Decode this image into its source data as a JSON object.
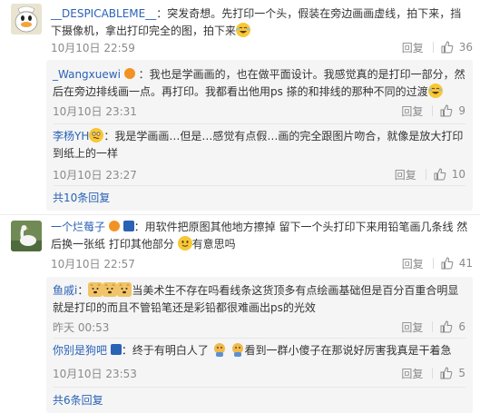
{
  "comments": [
    {
      "user": "__DESPICABLEME__",
      "text": "：突发奇想。先打印一个头，假装在旁边画画虚线，拍下来，挡下摄像机，拿出打印完全的图，拍下来",
      "time": "10月10日 22:59",
      "reply_label": "回复",
      "likes": "36",
      "replies": [
        {
          "user": "_Wangxuewi",
          "text": "：我也是学画画的，也在做平面设计。我感觉真的是打印一部分，然后在旁边排线画一点。再打印。我都看出他用ps 搽的和排线的那种不同的过渡",
          "time": "10月10日 23:31",
          "reply_label": "回复",
          "likes": "9"
        },
        {
          "user": "李杨YH",
          "text": "：我是学画画…但是…感觉有点假…画的完全跟图片吻合，就像是放大打印到纸上的一样",
          "time": "10月10日 23:27",
          "reply_label": "回复",
          "likes": "10"
        }
      ],
      "more": "共10条回复"
    },
    {
      "user": "一个烂莓子",
      "text": "：用软件把原图其他地方擦掉 留下一个头打印下来用铅笔画几条线 然后换一张纸 打印其他部分",
      "text_tail": "有意思吗",
      "time": "10月10日 22:57",
      "reply_label": "回复",
      "likes": "41",
      "replies": [
        {
          "user": "鱼戚i",
          "text": "：",
          "text_body": "当美术生不存在吗看线条这货顶多有点绘画基础但是百分百重合明显就是打印的而且不管铅笔还是彩铅都很难画出ps的光效",
          "time": "昨天 00:53",
          "reply_label": "回复",
          "likes": "6"
        },
        {
          "user": "你别是狗吧",
          "text": "：终于有明白人了",
          "text_tail": "看到一群小傻子在那说好厉害我真是干着急",
          "time": "10月10日 23:53",
          "reply_label": "回复",
          "likes": "5"
        }
      ],
      "more": "共6条回复"
    }
  ],
  "colors": {
    "link": "#2a62b6",
    "meta": "#8a8a8a",
    "reply_bg": "#f5f5f5"
  },
  "icons": [
    "avatar-duck",
    "avatar-goose",
    "verified-badge",
    "like-icon",
    "laugh-emoji",
    "confused-emoji",
    "smile-emoji",
    "doge-emoji",
    "dog-emoji"
  ]
}
